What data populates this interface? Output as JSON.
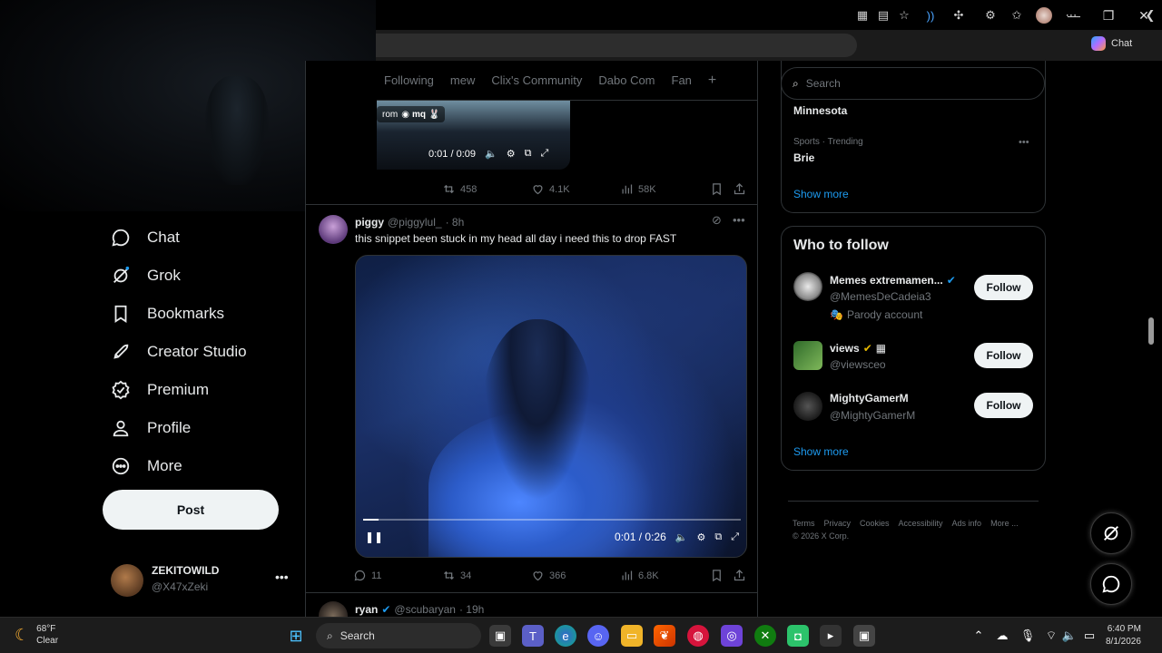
{
  "window": {
    "minimize": "—",
    "maximize": "❐",
    "close": "✕"
  },
  "browser": {
    "copilot_label": "Chat"
  },
  "tabs": [
    "Following",
    "mew",
    "Clix's Community",
    "Dabo Com",
    "Fan",
    "+"
  ],
  "prev_post": {
    "tag_text": "rom",
    "tag_user": "mq",
    "time": "0:01 / 0:09",
    "retweets": "458",
    "likes": "4.1K",
    "views": "58K"
  },
  "nav": {
    "items": [
      "Chat",
      "Grok",
      "Bookmarks",
      "Creator Studio",
      "Premium",
      "Profile",
      "More"
    ],
    "post_label": "Post"
  },
  "account": {
    "name": "ZEKITOWILD",
    "handle": "@X47xZeki"
  },
  "post": {
    "name": "piggy",
    "handle": "@piggylul_",
    "time": "· 8h",
    "text": "this snippet been stuck in my head all day i need this to drop FAST",
    "video_time": "0:01 / 0:26",
    "progress": 0.04,
    "replies": "11",
    "retweets": "34",
    "likes": "366",
    "views": "6.8K"
  },
  "next_post": {
    "name": "ryan",
    "handle": "@scubaryan",
    "time": "· 19h"
  },
  "search": {
    "placeholder": "Search"
  },
  "trends": {
    "partial_top": "Minnesota",
    "item_meta": "Sports · Trending",
    "item_name": "Brie",
    "show_more": "Show more"
  },
  "who_to_follow": {
    "title": "Who to follow",
    "follow_label": "Follow",
    "show_more": "Show more",
    "accounts": [
      {
        "name": "Memes extremamen...",
        "handle": "@MemesDeCadeia3",
        "note": "Parody account"
      },
      {
        "name": "views",
        "handle": "@viewsceo"
      },
      {
        "name": "MightyGamerM",
        "handle": "@MightyGamerM"
      }
    ]
  },
  "footer": {
    "links": [
      "Terms",
      "Privacy",
      "Cookies",
      "Accessibility",
      "Ads info",
      "More ..."
    ],
    "copyright": "© 2026 X Corp."
  },
  "taskbar": {
    "weather_temp": "68°F",
    "weather_desc": "Clear",
    "search_label": "Search",
    "time": "6:40 PM",
    "date": "8/1/2026"
  }
}
